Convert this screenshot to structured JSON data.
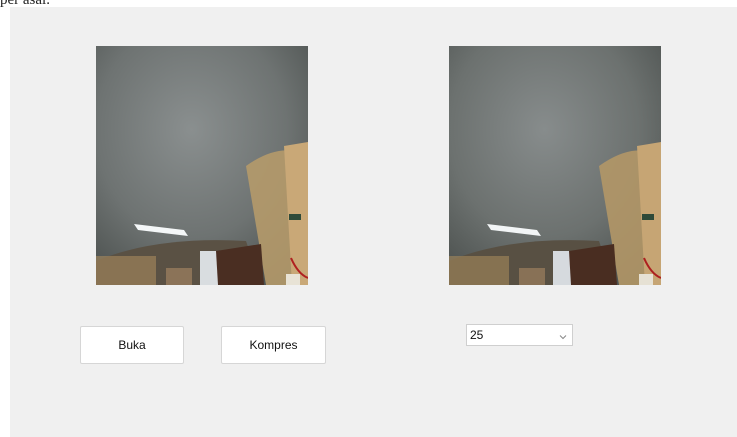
{
  "page_fragment_text": "per asal.",
  "buttons": {
    "open_label": "Buka",
    "compress_label": "Kompres"
  },
  "quality_select": {
    "selected_value": "25"
  },
  "icons": {
    "dropdown": "chevron-down-icon"
  }
}
